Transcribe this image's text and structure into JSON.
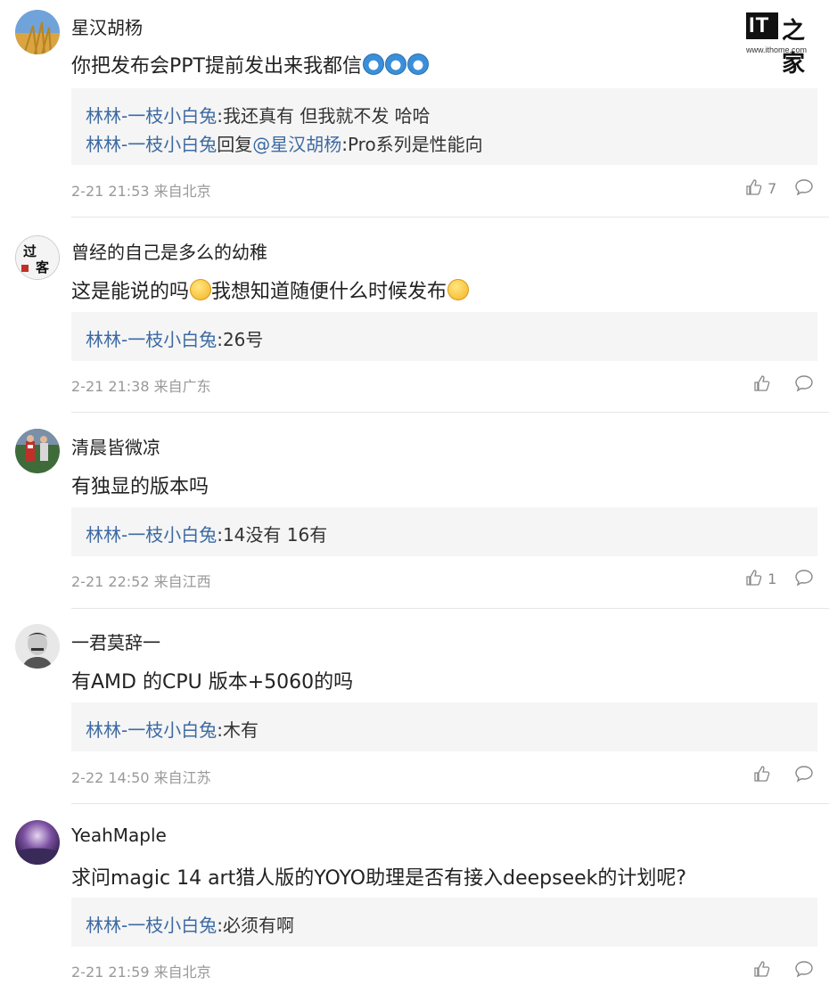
{
  "logo": {
    "mark": "IT",
    "name": "之家",
    "url": "www.ithome.com"
  },
  "comments": [
    {
      "user": "星汉胡杨",
      "text": "你把发布会PPT提前发出来我都信",
      "emojis": [
        "doraemon-emoji",
        "doraemon-emoji",
        "doraemon-emoji"
      ],
      "replies": [
        {
          "name": "林林-一枝小白兔",
          "text": ":我还真有 但我就不发 哈哈"
        },
        {
          "name": "林林-一枝小白兔",
          "sep": "回复",
          "mention": "@星汉胡杨",
          "text": ":Pro系列是性能向"
        }
      ],
      "meta": "2-21 21:53 来自北京",
      "likes": "7"
    },
    {
      "user": "曾经的自己是多么的幼稚",
      "text_a": "这是能说的吗",
      "text_b": "我想知道随便什么时候发布",
      "replies": [
        {
          "name": "林林-一枝小白兔",
          "text": ":26号"
        }
      ],
      "meta": "2-21 21:38 来自广东",
      "likes": ""
    },
    {
      "user": "清晨皆微凉",
      "text": "有独显的版本吗",
      "replies": [
        {
          "name": "林林-一枝小白兔",
          "text": ":14没有 16有"
        }
      ],
      "meta": "2-21 22:52 来自江西",
      "likes": "1"
    },
    {
      "user": "一君莫辞一",
      "text": "有AMD 的CPU 版本+5060的吗",
      "replies": [
        {
          "name": "林林-一枝小白兔",
          "text": ":木有"
        }
      ],
      "meta": "2-22 14:50 来自江苏",
      "likes": ""
    },
    {
      "user": "YeahMaple",
      "text": "求问magic 14 art猎人版的YOYO助理是否有接入deepseek的计划呢?",
      "replies": [
        {
          "name": "林林-一枝小白兔",
          "text": ":必须有啊"
        }
      ],
      "meta": "2-21 21:59 来自北京",
      "likes": ""
    }
  ]
}
